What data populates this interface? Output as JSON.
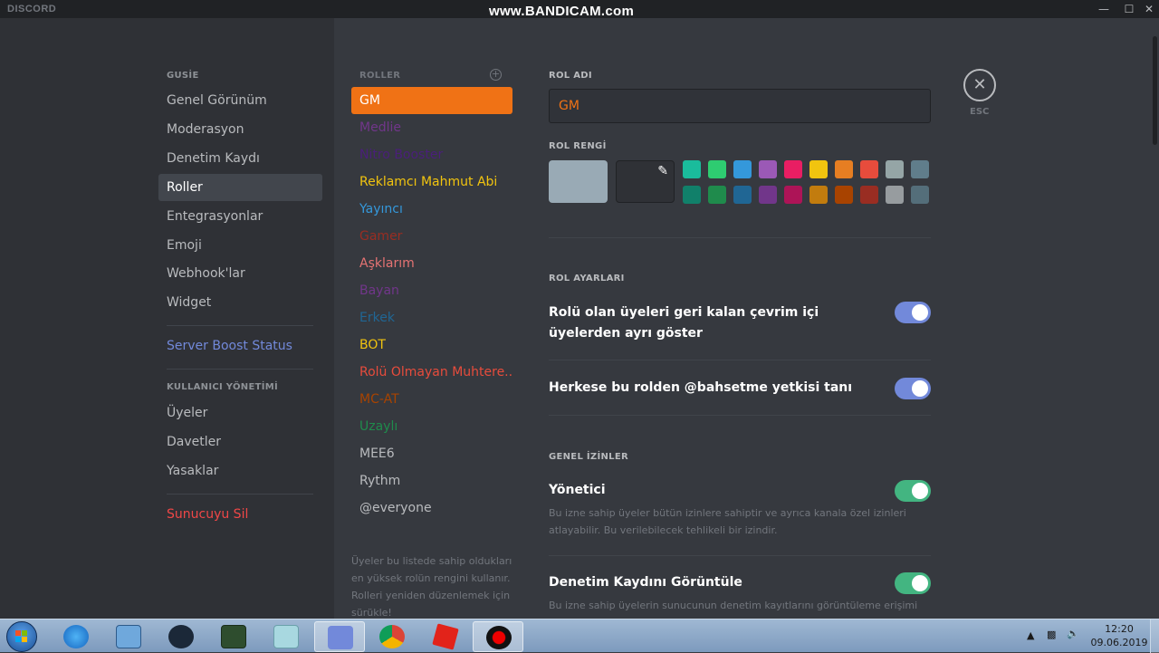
{
  "titlebar": {
    "brand": "DISCORD",
    "watermark": "www.BANDICAM.com"
  },
  "sidebar": {
    "section_server": "GUSİE",
    "items": [
      {
        "label": "Genel Görünüm"
      },
      {
        "label": "Moderasyon"
      },
      {
        "label": "Denetim Kaydı"
      },
      {
        "label": "Roller",
        "active": true
      },
      {
        "label": "Entegrasyonlar"
      },
      {
        "label": "Emoji"
      },
      {
        "label": "Webhook'lar"
      },
      {
        "label": "Widget"
      }
    ],
    "boost": "Server Boost Status",
    "section_users": "KULLANICI YÖNETİMİ",
    "user_items": [
      {
        "label": "Üyeler"
      },
      {
        "label": "Davetler"
      },
      {
        "label": "Yasaklar"
      }
    ],
    "delete": "Sunucuyu Sil"
  },
  "roles": {
    "header": "ROLLER",
    "list": [
      {
        "name": "GM",
        "color": "#ffffff",
        "selected": true
      },
      {
        "name": "Medlie",
        "color": "#71368a"
      },
      {
        "name": "Nitro Booster",
        "color": "#4a1f7a"
      },
      {
        "name": "Reklamcı Mahmut Abi",
        "color": "#f1c40f"
      },
      {
        "name": "Yayıncı",
        "color": "#3498db"
      },
      {
        "name": "Gamer",
        "color": "#992d22"
      },
      {
        "name": "Aşklarım",
        "color": "#e57373"
      },
      {
        "name": "Bayan",
        "color": "#71368a"
      },
      {
        "name": "Erkek",
        "color": "#206694"
      },
      {
        "name": "BOT",
        "color": "#f1c40f"
      },
      {
        "name": "Rolü Olmayan Muhtere...",
        "color": "#e74c3c"
      },
      {
        "name": "MC-AT",
        "color": "#a84300"
      },
      {
        "name": "Uzaylı",
        "color": "#1f8b4c"
      },
      {
        "name": "MEE6",
        "color": "#b9bbbe"
      },
      {
        "name": "Rythm",
        "color": "#b9bbbe"
      },
      {
        "name": "@everyone",
        "color": "#b9bbbe"
      }
    ],
    "note": "Üyeler bu listede sahip oldukları en yüksek rolün rengini kullanır. Rolleri yeniden düzenlemek için sürükle!"
  },
  "editor": {
    "name_label": "ROL ADI",
    "name_value": "GM",
    "color_label": "ROL RENGİ",
    "default_color": "#99aab5",
    "palette_top": [
      "#1abc9c",
      "#2ecc71",
      "#3498db",
      "#9b59b6",
      "#e91e63",
      "#f1c40f",
      "#e67e22",
      "#e74c3c",
      "#95a5a6",
      "#607d8b"
    ],
    "palette_bottom": [
      "#11806a",
      "#1f8b4c",
      "#206694",
      "#71368a",
      "#ad1457",
      "#c27c0e",
      "#a84300",
      "#992d22",
      "#979c9f",
      "#546e7a"
    ],
    "settings_label": "ROL AYARLARI",
    "setting_hoist": "Rolü olan üyeleri geri kalan çevrim içi üyelerden ayrı göster",
    "setting_mention_pre": "Herkese bu rolden ",
    "setting_mention_bold": "@bahsetme",
    "setting_mention_post": " yetkisi tanı",
    "general_label": "GENEL İZİNLER",
    "perm_admin": "Yönetici",
    "perm_admin_desc": "Bu izne sahip üyeler bütün izinlere sahiptir ve ayrıca kanala özel izinleri atlayabilir. Bu verilebilecek tehlikeli bir izindir.",
    "perm_audit": "Denetim Kaydını Görüntüle",
    "perm_audit_desc": "Bu izne sahip üyelerin sunucunun denetim kayıtlarını görüntüleme erişimi"
  },
  "esc": {
    "icon": "close-icon",
    "label": "ESC"
  },
  "taskbar": {
    "time": "12:20",
    "date": "09.06.2019"
  }
}
